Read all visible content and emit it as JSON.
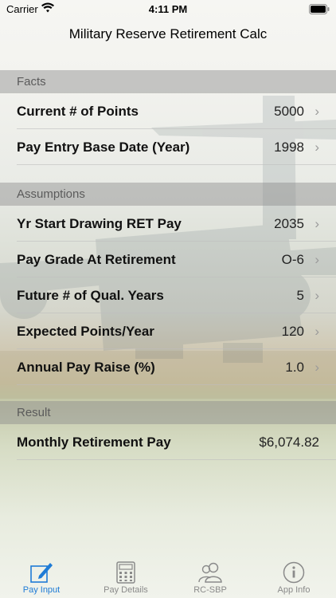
{
  "status_bar": {
    "carrier": "Carrier",
    "time": "4:11 PM"
  },
  "nav": {
    "title": "Military Reserve Retirement Calc"
  },
  "sections": {
    "facts": {
      "header": "Facts",
      "rows": [
        {
          "label": "Current # of Points",
          "value": "5000"
        },
        {
          "label": "Pay Entry Base Date (Year)",
          "value": "1998"
        }
      ]
    },
    "assumptions": {
      "header": "Assumptions",
      "rows": [
        {
          "label": "Yr Start Drawing RET Pay",
          "value": "2035"
        },
        {
          "label": "Pay Grade At Retirement",
          "value": "O-6"
        },
        {
          "label": "Future # of Qual. Years",
          "value": "5"
        },
        {
          "label": "Expected Points/Year",
          "value": "120"
        },
        {
          "label": "Annual Pay Raise (%)",
          "value": "1.0"
        }
      ]
    },
    "result": {
      "header": "Result",
      "rows": [
        {
          "label": "Monthly Retirement Pay",
          "value": "$6,074.82"
        }
      ]
    }
  },
  "chevron": "›",
  "tabs": [
    {
      "label": "Pay Input",
      "icon": "edit-icon",
      "active": true
    },
    {
      "label": "Pay Details",
      "icon": "calculator-icon",
      "active": false
    },
    {
      "label": "RC-SBP",
      "icon": "people-icon",
      "active": false
    },
    {
      "label": "App Info",
      "icon": "info-icon",
      "active": false
    }
  ],
  "colors": {
    "accent": "#1e7bd6",
    "section_header_bg": "#a4a4a4",
    "inactive_tab": "#8a8a8a"
  }
}
